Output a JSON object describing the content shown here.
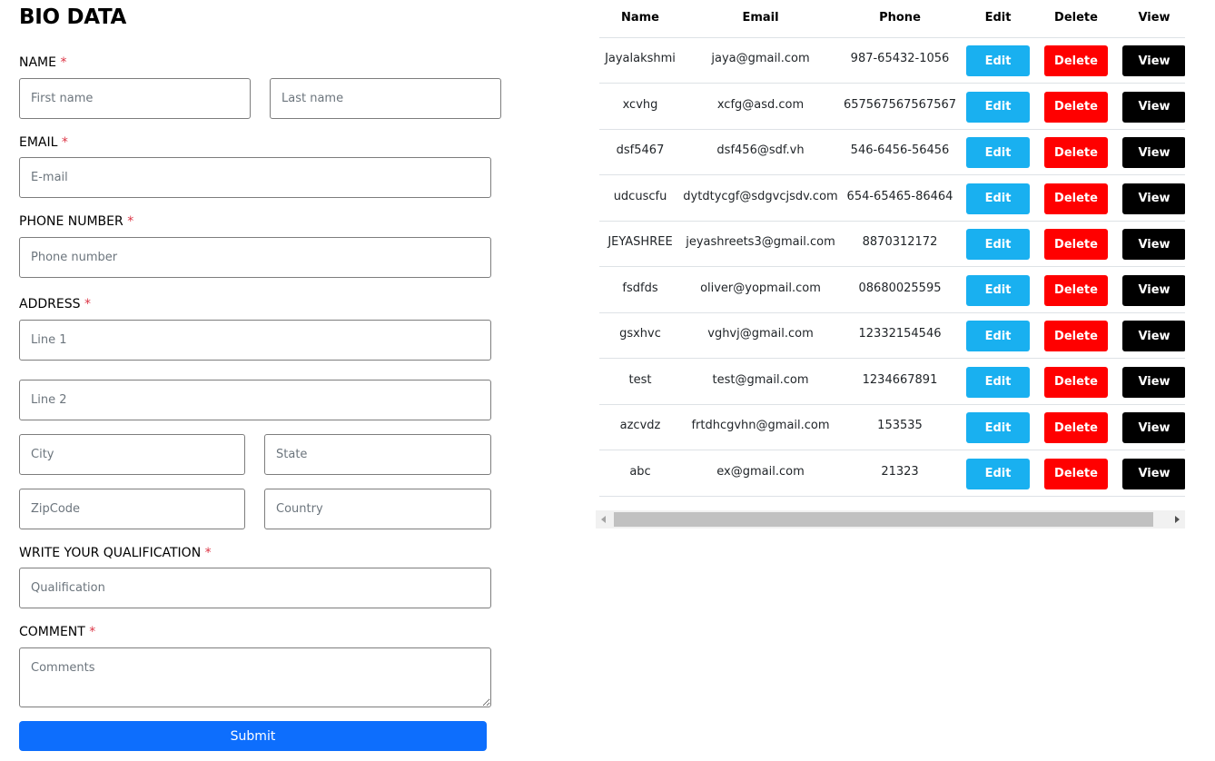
{
  "form": {
    "title": "BIO DATA",
    "required_mark": "*",
    "name_label": "NAME",
    "first_name_placeholder": "First name",
    "last_name_placeholder": "Last name",
    "email_label": "EMAIL",
    "email_placeholder": "E-mail",
    "phone_label": "PHONE NUMBER",
    "phone_placeholder": "Phone number",
    "address_label": "ADDRESS",
    "line1_placeholder": "Line 1",
    "line2_placeholder": "Line 2",
    "city_placeholder": "City",
    "state_placeholder": "State",
    "zip_placeholder": "ZipCode",
    "country_placeholder": "Country",
    "qualification_label": "WRITE YOUR QUALIFICATION",
    "qualification_placeholder": "Qualification",
    "comment_label": "COMMENT",
    "comment_placeholder": "Comments",
    "submit_label": "Submit"
  },
  "table": {
    "headers": {
      "name": "Name",
      "email": "Email",
      "phone": "Phone",
      "edit": "Edit",
      "delete": "Delete",
      "view": "View"
    },
    "buttons": {
      "edit": "Edit",
      "delete": "Delete",
      "view": "View"
    },
    "rows": [
      {
        "name": "Jayalakshmi",
        "email": "jaya@gmail.com",
        "phone": "987-65432-1056"
      },
      {
        "name": "xcvhg",
        "email": "xcfg@asd.com",
        "phone": "657567567567567"
      },
      {
        "name": "dsf5467",
        "email": "dsf456@sdf.vh",
        "phone": "546-6456-56456"
      },
      {
        "name": "udcuscfu",
        "email": "dytdtycgf@sdgvcjsdv.com",
        "phone": "654-65465-86464"
      },
      {
        "name": "JEYASHREE",
        "email": "jeyashreets3@gmail.com",
        "phone": "8870312172"
      },
      {
        "name": "fsdfds",
        "email": "oliver@yopmail.com",
        "phone": "08680025595"
      },
      {
        "name": "gsxhvc",
        "email": "vghvj@gmail.com",
        "phone": "12332154546"
      },
      {
        "name": "test",
        "email": "test@gmail.com",
        "phone": "1234667891"
      },
      {
        "name": "azcvdz",
        "email": "frtdhcgvhn@gmail.com",
        "phone": "153535"
      },
      {
        "name": "abc",
        "email": "ex@gmail.com",
        "phone": "21323"
      }
    ]
  },
  "colors": {
    "primary": "#0d6efd",
    "edit": "#19b0f0",
    "delete": "#ff0000",
    "view": "#000000",
    "required": "#dc3545"
  }
}
